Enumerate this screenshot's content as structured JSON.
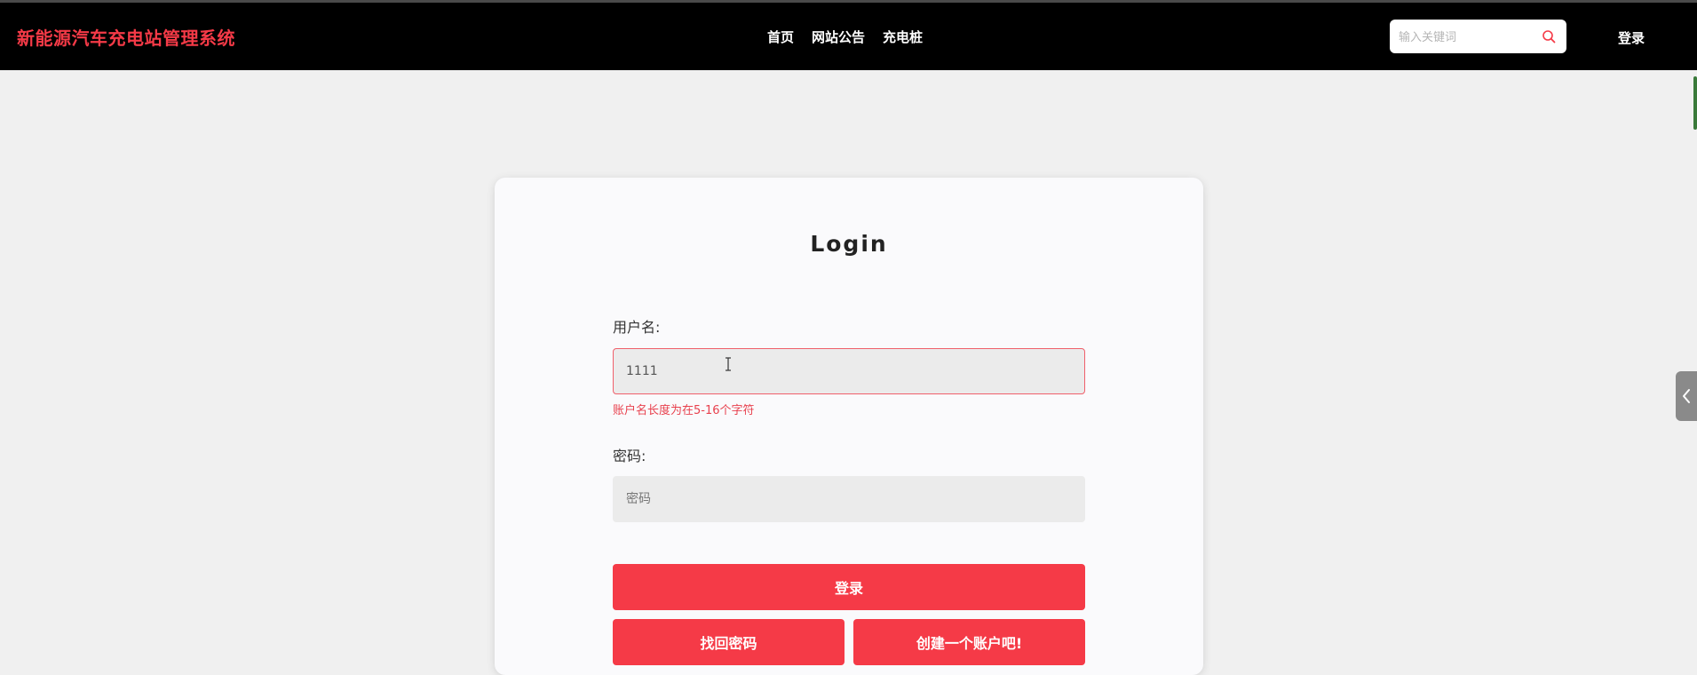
{
  "header": {
    "brand": "新能源汽车充电站管理系统",
    "nav": [
      "首页",
      "网站公告",
      "充电桩"
    ],
    "search_placeholder": "输入关键词",
    "login_label": "登录"
  },
  "login_form": {
    "title": "Login",
    "username_label": "用户名:",
    "username_value": "1111",
    "username_error": "账户名长度为在5-16个字符",
    "password_label": "密码:",
    "password_placeholder": "密码",
    "submit_label": "登录",
    "forgot_label": "找回密码",
    "register_label": "创建一个账户吧!"
  },
  "colors": {
    "accent": "#f53a47",
    "header_bg": "#000000",
    "page_bg": "#f0f0f0",
    "card_bg": "#fafafc",
    "field_bg": "#ebebeb",
    "error": "#e8414e"
  },
  "icons": {
    "search": "search-icon",
    "side_tab": "chevron-left-icon",
    "text_cursor": "i-beam-cursor-icon"
  }
}
